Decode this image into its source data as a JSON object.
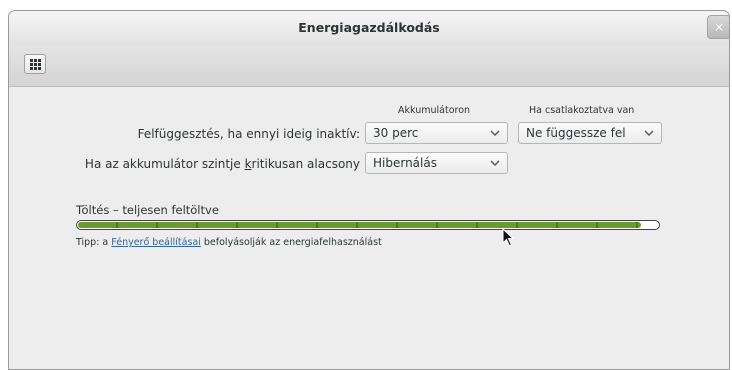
{
  "window": {
    "title": "Energiagazdálkodás",
    "close_glyph": "×"
  },
  "toolbar": {
    "grid_icon": "app-grid-icon"
  },
  "columns": {
    "battery": "Akkumulátoron",
    "plugged": "Ha csatlakoztatva van"
  },
  "rows": [
    {
      "label": "Felfüggesztés, ha ennyi ideig inaktív:",
      "battery_value": "30 perc",
      "plugged_value": "Ne függessze fel"
    },
    {
      "label_pre": "Ha az akkumulátor szintje ",
      "label_mnemonic": "k",
      "label_post": "ritikusan alacsony",
      "battery_value": "Hibernálás"
    }
  ],
  "charge": {
    "label": "Töltés – teljesen feltöltve",
    "level": 0.97
  },
  "tip": {
    "prefix": "Tipp: a ",
    "link": "Fényerő beállításai",
    "suffix": " befolyásolják az energiafelhasználást"
  },
  "colors": {
    "progress": "#6a9b2e",
    "link": "#3465a4"
  }
}
